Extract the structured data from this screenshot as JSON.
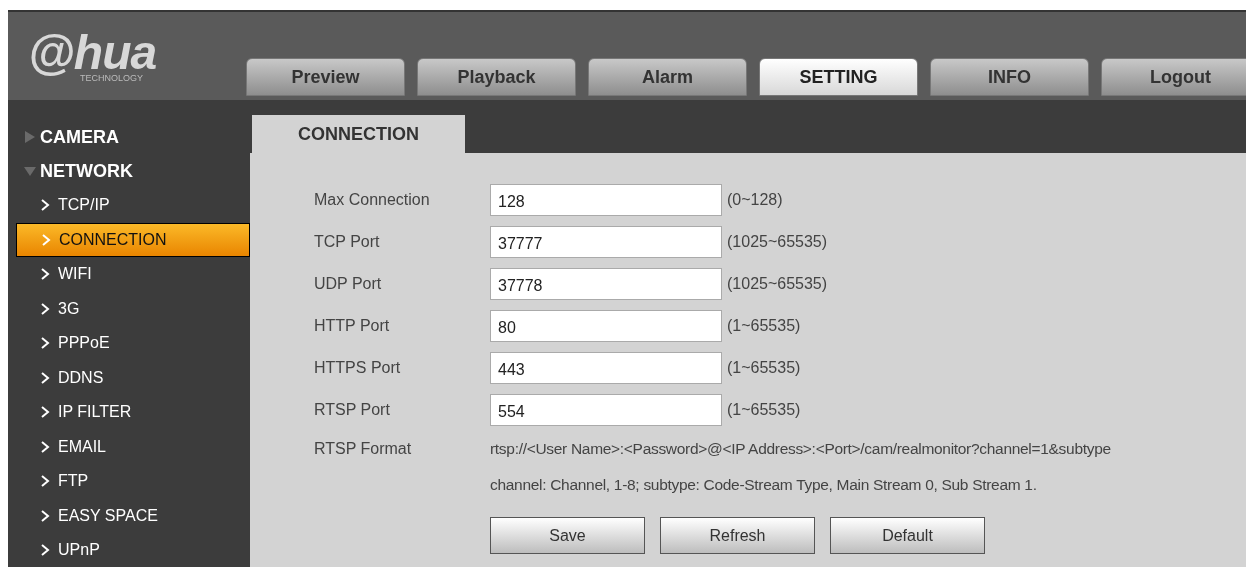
{
  "logo": {
    "brand": "@hua",
    "tagline": "TECHNOLOGY"
  },
  "tabs": [
    {
      "label": "Preview",
      "selected": false
    },
    {
      "label": "Playback",
      "selected": false
    },
    {
      "label": "Alarm",
      "selected": false
    },
    {
      "label": "SETTING",
      "selected": true
    },
    {
      "label": "INFO",
      "selected": false
    },
    {
      "label": "Logout",
      "selected": false
    }
  ],
  "sidebar": {
    "items": [
      {
        "label": "CAMERA",
        "expanded": false
      },
      {
        "label": "NETWORK",
        "expanded": true,
        "children": [
          {
            "label": "TCP/IP",
            "selected": false
          },
          {
            "label": "CONNECTION",
            "selected": true
          },
          {
            "label": "WIFI",
            "selected": false
          },
          {
            "label": "3G",
            "selected": false
          },
          {
            "label": "PPPoE",
            "selected": false
          },
          {
            "label": "DDNS",
            "selected": false
          },
          {
            "label": "IP FILTER",
            "selected": false
          },
          {
            "label": "EMAIL",
            "selected": false
          },
          {
            "label": "FTP",
            "selected": false
          },
          {
            "label": "EASY SPACE",
            "selected": false
          },
          {
            "label": "UPnP",
            "selected": false
          }
        ]
      }
    ]
  },
  "section_title": "CONNECTION",
  "fields": [
    {
      "label": "Max Connection",
      "value": "128",
      "range": "(0~128)"
    },
    {
      "label": "TCP Port",
      "value": "37777",
      "range": "(1025~65535)"
    },
    {
      "label": "UDP Port",
      "value": "37778",
      "range": "(1025~65535)"
    },
    {
      "label": "HTTP Port",
      "value": "80",
      "range": "(1~65535)"
    },
    {
      "label": "HTTPS Port",
      "value": "443",
      "range": "(1~65535)"
    },
    {
      "label": "RTSP Port",
      "value": "554",
      "range": "(1~65535)"
    }
  ],
  "rtsp_format": {
    "label": "RTSP Format",
    "url": "rtsp://<User Name>:<Password>@<IP Address>:<Port>/cam/realmonitor?channel=1&subtype",
    "note": "channel: Channel, 1-8; subtype: Code-Stream Type, Main Stream 0, Sub Stream 1."
  },
  "buttons": [
    "Save",
    "Refresh",
    "Default"
  ]
}
